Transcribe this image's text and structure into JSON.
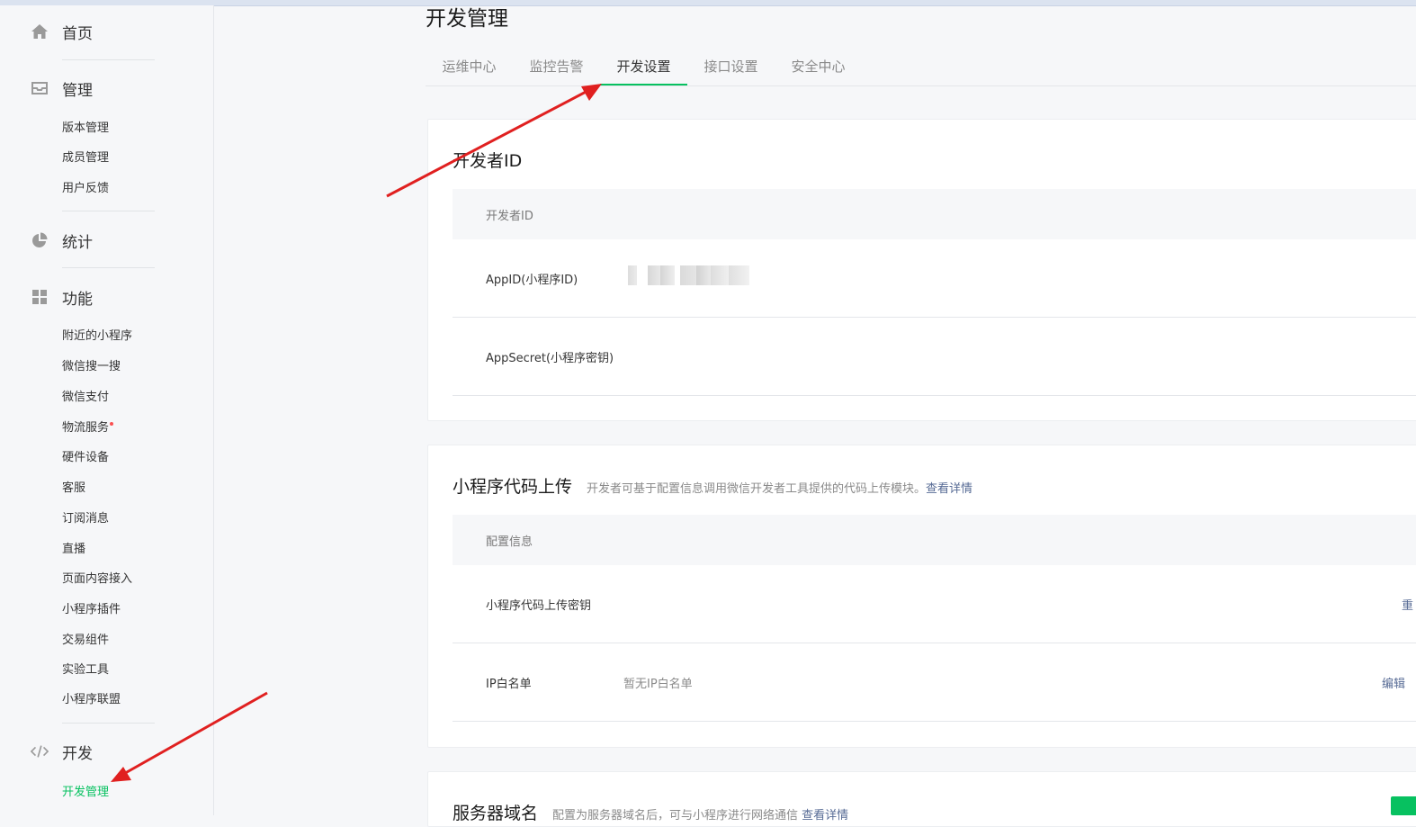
{
  "sidebar": {
    "groups": [
      {
        "icon": "home-icon",
        "label": "首页"
      },
      {
        "icon": "inbox-icon",
        "label": "管理",
        "items": [
          "版本管理",
          "成员管理",
          "用户反馈"
        ]
      },
      {
        "icon": "pie-chart-icon",
        "label": "统计"
      },
      {
        "icon": "grid-icon",
        "label": "功能",
        "items": [
          "附近的小程序",
          "微信搜一搜",
          "微信支付",
          "物流服务",
          "硬件设备",
          "客服",
          "订阅消息",
          "直播",
          "页面内容接入",
          "小程序插件",
          "交易组件",
          "实验工具",
          "小程序联盟"
        ]
      },
      {
        "icon": "code-icon",
        "label": "开发",
        "items": [
          "开发管理"
        ]
      }
    ]
  },
  "main": {
    "title": "开发管理",
    "tabs": [
      "运维中心",
      "监控告警",
      "开发设置",
      "接口设置",
      "安全中心"
    ],
    "active_tab": "开发设置"
  },
  "dev_id": {
    "title": "开发者ID",
    "header": "开发者ID",
    "rows": [
      {
        "key": "AppID(小程序ID)"
      },
      {
        "key": "AppSecret(小程序密钥)"
      }
    ]
  },
  "upload": {
    "title": "小程序代码上传",
    "desc": "开发者可基于配置信息调用微信开发者工具提供的代码上传模块。",
    "link": "查看详情",
    "header": "配置信息",
    "rows": [
      {
        "key": "小程序代码上传密钥",
        "action": "重"
      },
      {
        "key": "IP白名单",
        "value": "暂无IP白名单",
        "action": "编辑"
      }
    ]
  },
  "server": {
    "title": "服务器域名",
    "desc": "配置为服务器域名后，可与小程序进行网络通信",
    "link": "查看详情"
  },
  "colors": {
    "accent": "#07c160",
    "link": "#576b95",
    "annotation": "#e02020"
  }
}
